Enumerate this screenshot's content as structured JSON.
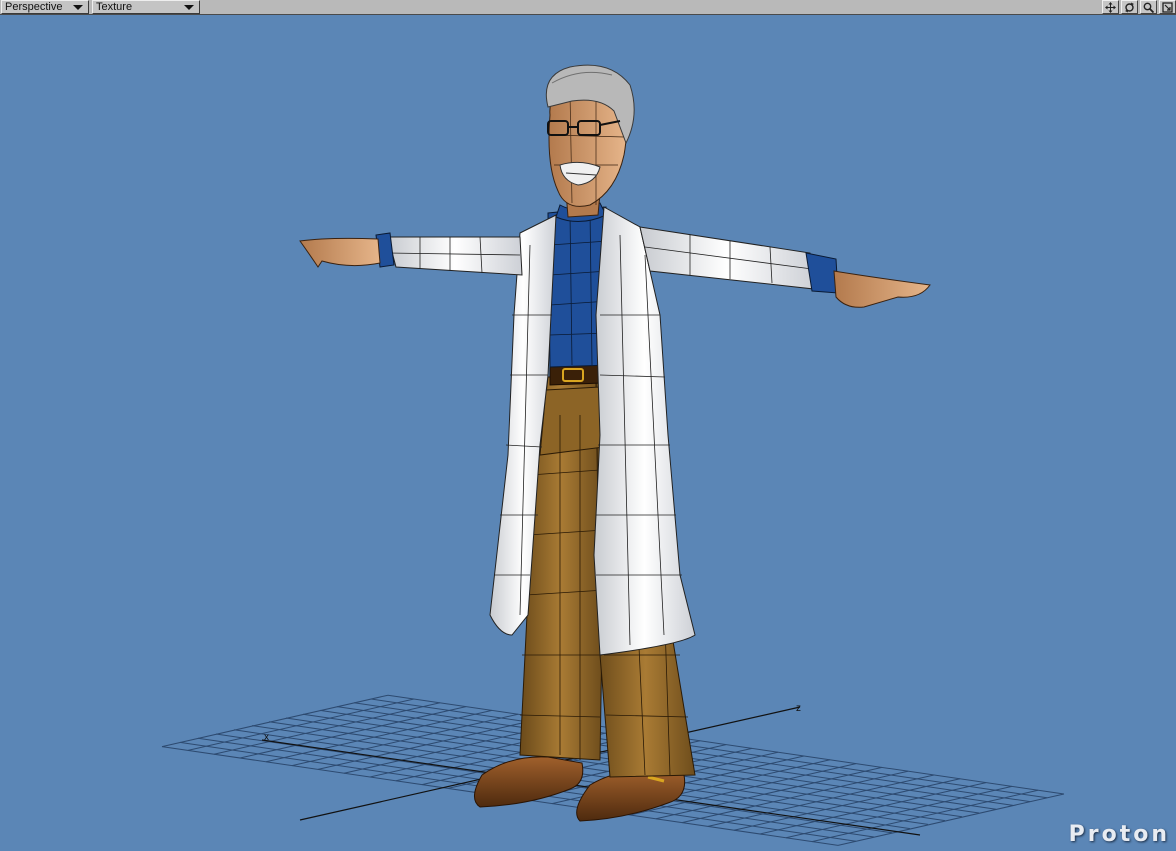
{
  "toolbar": {
    "view_label": "Perspective",
    "shading_label": "Texture",
    "tools": [
      {
        "name": "move-view-icon"
      },
      {
        "name": "rotate-view-icon"
      },
      {
        "name": "zoom-view-icon"
      },
      {
        "name": "maximize-view-icon"
      }
    ]
  },
  "viewport": {
    "background_color": "#5b86b6",
    "grid_color": "#2d4a70",
    "axis_x_label": "x",
    "axis_z_label": "z"
  },
  "watermark": "Proton"
}
